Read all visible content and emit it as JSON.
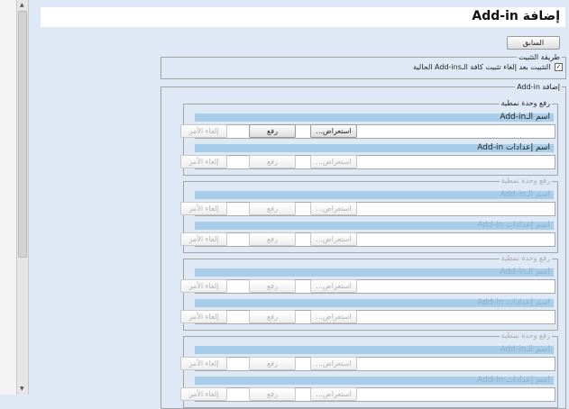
{
  "window": {
    "title": "إضافة Add-in"
  },
  "toolbar": {
    "back_label": "السابق"
  },
  "uninstall": {
    "legend": "طريقة التثبيت",
    "checkbox_label": "التثبيت بعد إلغاء تثبيت كافة الـAdd-ins الحالية",
    "checked": true
  },
  "add": {
    "legend": "إضافة Add-in",
    "upload_legend": "رفع وحدة نمطية",
    "module_name_label": "اسم الـAdd-in",
    "settings_name_label": "اسم إعدادات Add-in",
    "browse_label": "استعراض...",
    "upload_label": "رفع",
    "cancel_label": "إلغاء الأمر"
  },
  "scrollbar": {
    "up_glyph": "▲",
    "down_glyph": "▼",
    "grip_glyph": "≡"
  }
}
